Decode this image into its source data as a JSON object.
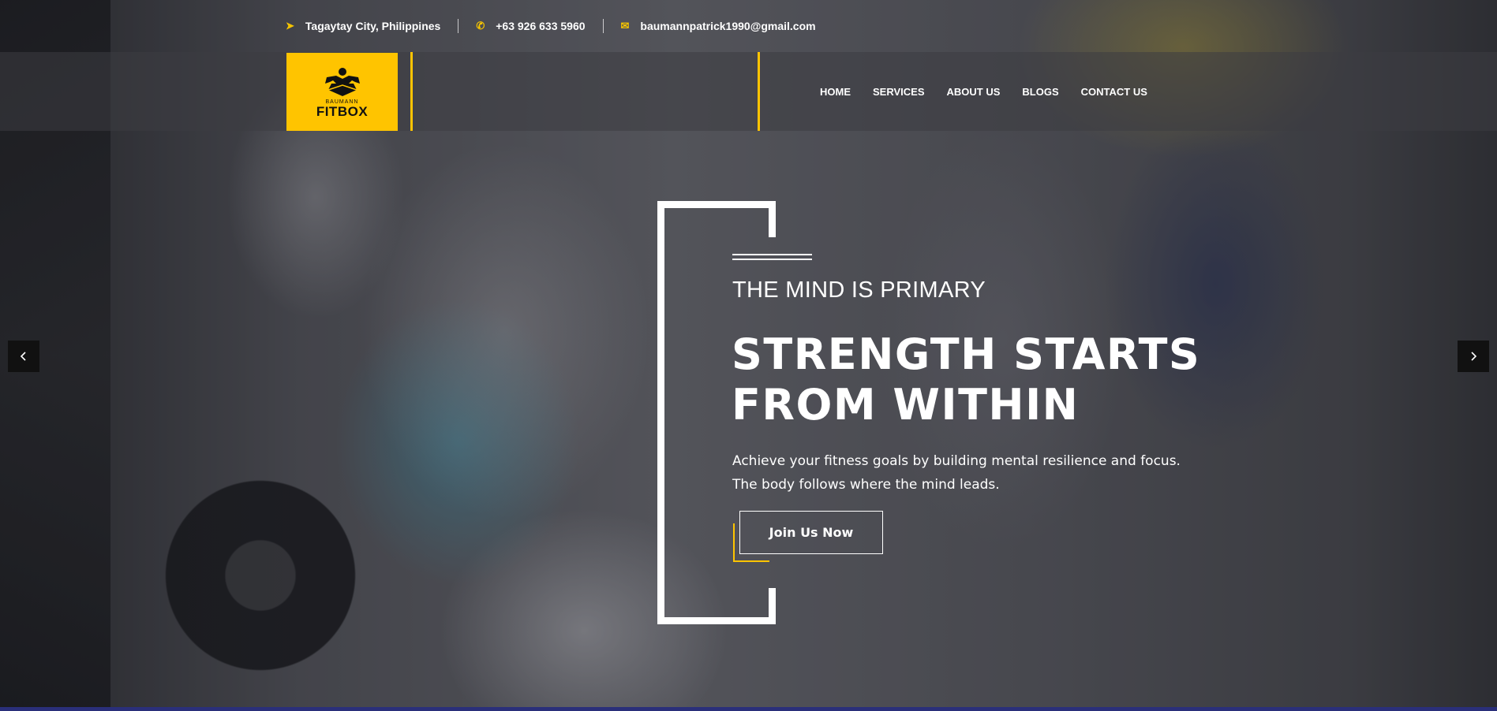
{
  "topbar": {
    "location": "Tagaytay City, Philippines",
    "phone": "+63 926 633 5960",
    "email": "baumannpatrick1990@gmail.com",
    "icons": [
      "location-arrow-icon",
      "phone-icon",
      "envelope-icon"
    ]
  },
  "logo": {
    "small_text": "BAUMANN",
    "brand": "FITBOX"
  },
  "nav": {
    "items": [
      "HOME",
      "SERVICES",
      "ABOUT US",
      "BLOGS",
      "CONTACT US"
    ]
  },
  "hero": {
    "subtitle": "THE MIND IS PRIMARY",
    "headline_line1": "STRENGTH STARTS",
    "headline_line2": "FROM WITHIN",
    "description_line1": "Achieve your fitness goals by building mental resilience and focus.",
    "description_line2": "The body follows where the mind leads.",
    "cta_label": "Join Us Now"
  },
  "slider": {
    "prev_icon": "chevron-left-icon",
    "next_icon": "chevron-right-icon"
  },
  "colors": {
    "accent": "#ffc400",
    "arrow_bg": "#111111",
    "text": "#ffffff"
  }
}
